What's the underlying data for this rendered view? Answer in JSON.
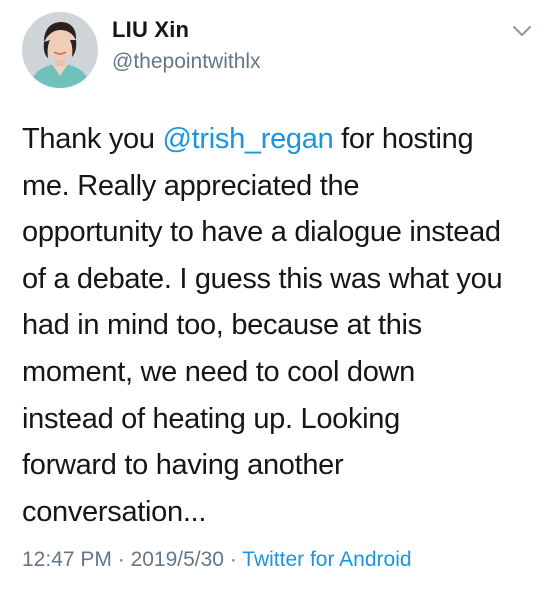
{
  "author": {
    "name": "LIU Xin",
    "handle": "@thepointwithlx"
  },
  "tweet": {
    "lines": [
      {
        "before": "Thank you ",
        "mention": "@trish_regan",
        "after": " for hosting"
      },
      {
        "text": "me.  Really appreciated the"
      },
      {
        "text": "opportunity to have a dialogue instead"
      },
      {
        "text": "of a debate.  I guess this was what you"
      },
      {
        "text": "had in mind too, because at this"
      },
      {
        "text": "moment, we need to cool down"
      },
      {
        "text": "instead of heating up.  Looking"
      },
      {
        "text": "forward to having another"
      },
      {
        "text": "conversation..."
      }
    ]
  },
  "meta": {
    "time": "12:47 PM",
    "separator": " · ",
    "date": "2019/5/30",
    "source": "Twitter for Android"
  },
  "icons": {
    "menu": "chevron-down-icon"
  },
  "colors": {
    "link": "#1b95e0",
    "secondary_text": "#657786",
    "primary_text": "#14171a"
  }
}
